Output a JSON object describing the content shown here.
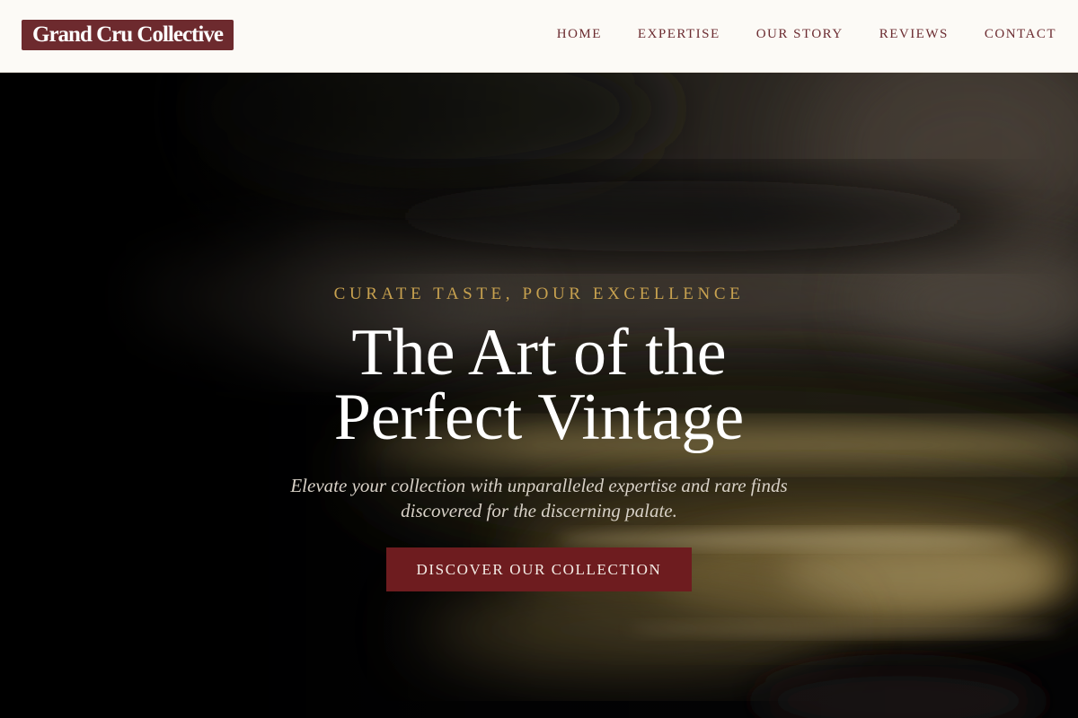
{
  "header": {
    "logo_text": "Grand Cru Collective",
    "nav": [
      {
        "label": "HOME"
      },
      {
        "label": "EXPERTISE"
      },
      {
        "label": "OUR STORY"
      },
      {
        "label": "REVIEWS"
      },
      {
        "label": "CONTACT"
      }
    ]
  },
  "hero": {
    "tagline": "CURATE TASTE, POUR EXCELLENCE",
    "headline_line1": "The Art of the",
    "headline_line2": "Perfect Vintage",
    "subtext_line1": "Elevate your collection with unparalleled expertise and rare finds",
    "subtext_line2": "discovered for the discerning palate.",
    "cta_label": "DISCOVER OUR COLLECTION",
    "background_image": "blurred-wine-glass-photo"
  },
  "colors": {
    "brand": "#6d2a2e",
    "header_bg": "#fcfaf6",
    "nav_text": "#6b2b30",
    "tagline_gold": "#c7a14f",
    "cta_bg": "#6e1c1f"
  }
}
